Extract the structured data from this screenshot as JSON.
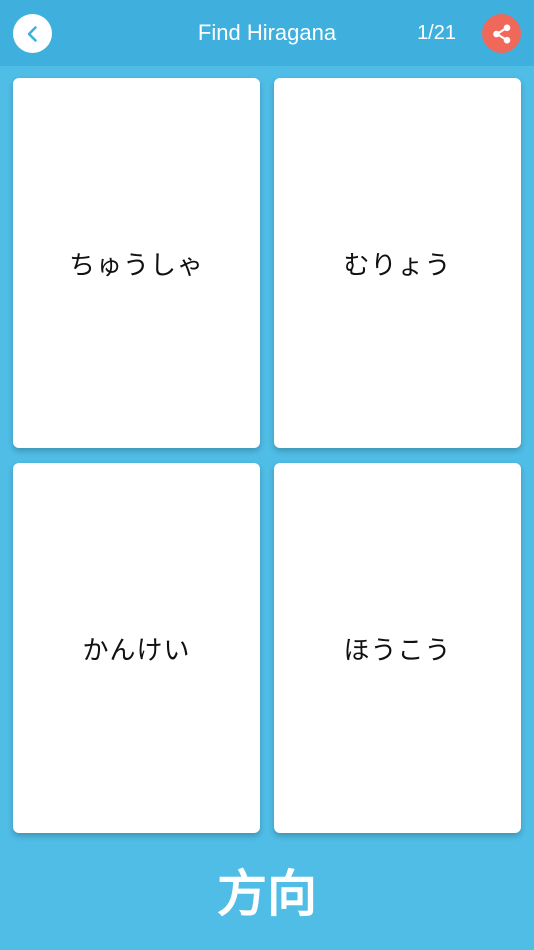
{
  "header": {
    "title": "Find Hiragana",
    "counter": "1/21",
    "back_icon": "chevron-left-icon",
    "share_icon": "share-icon"
  },
  "cards": [
    {
      "label": "ちゅうしゃ"
    },
    {
      "label": "むりょう"
    },
    {
      "label": "かんけい"
    },
    {
      "label": "ほうこう"
    }
  ],
  "prompt": {
    "kanji": "方向"
  },
  "colors": {
    "background": "#4fbde6",
    "header": "#3fb0de",
    "share_button": "#f0685a",
    "back_chevron": "#3fb0de",
    "card": "#ffffff"
  }
}
